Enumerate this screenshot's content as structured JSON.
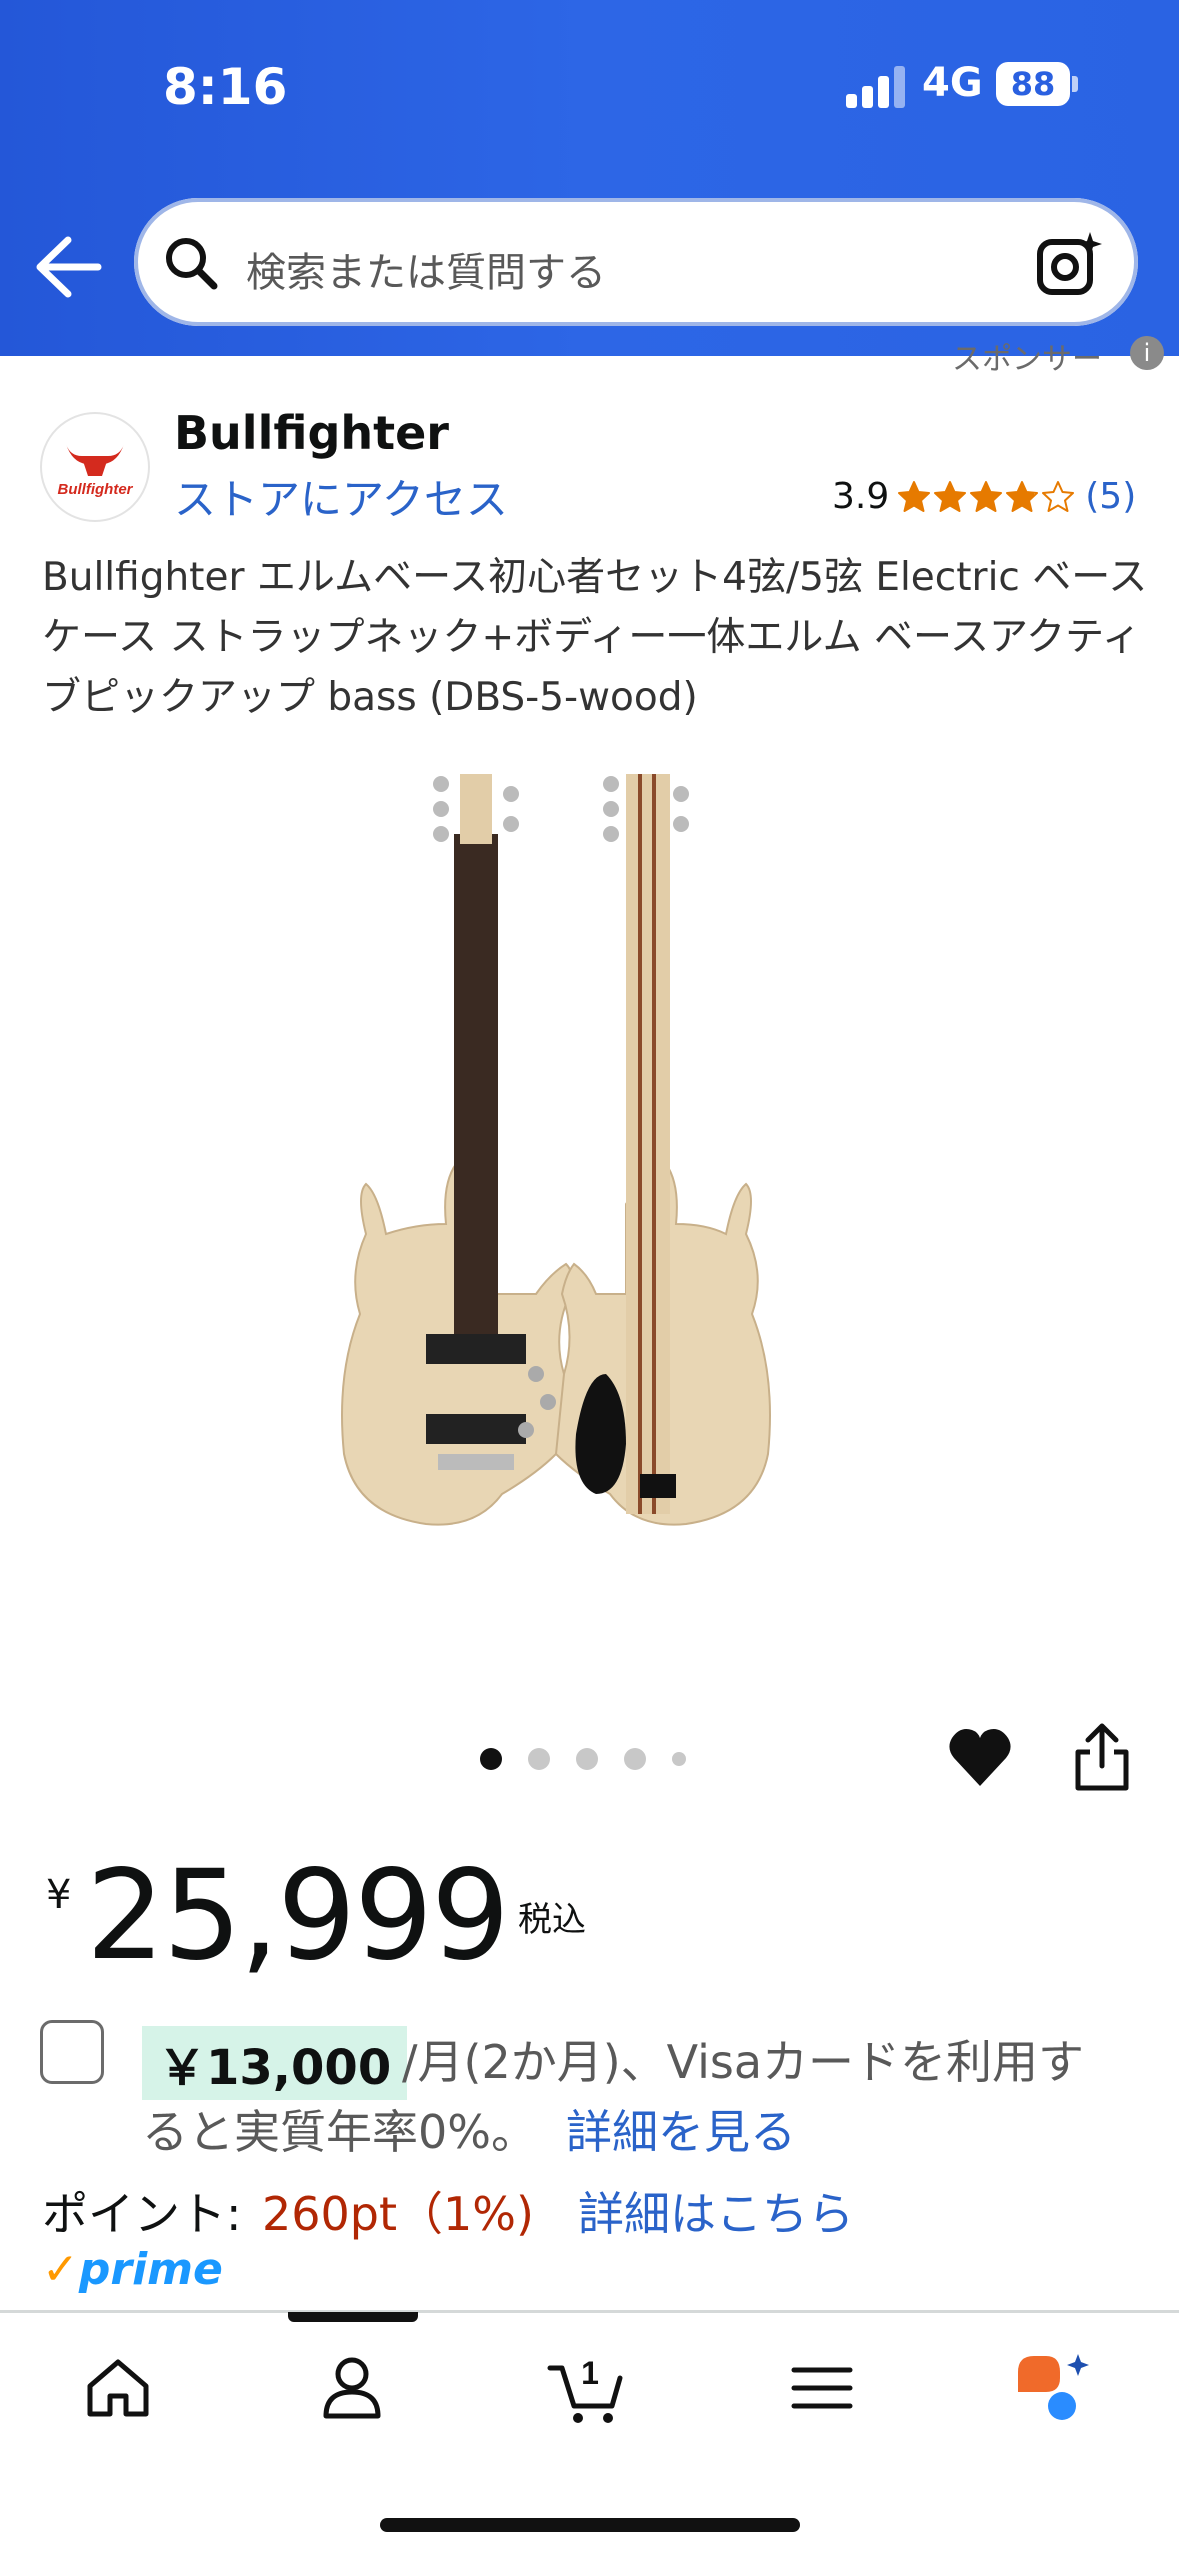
{
  "status": {
    "time": "8:16",
    "network": "4G",
    "battery": "88"
  },
  "search": {
    "placeholder": "検索または質問する"
  },
  "sponsor": {
    "label": "スポンサー",
    "info": "i"
  },
  "seller": {
    "brand": "Bullfighter",
    "logo_text": "Bullfighter",
    "store_link": "ストアにアクセス"
  },
  "rating": {
    "value": "3.9",
    "stars": 3.9,
    "count": "(5)"
  },
  "product": {
    "title": "Bullfighter エルムベース初心者セット4弦/5弦 Electric ベース ケース ストラップネック+ボディー一体エルム ベースアクティブピックアップ bass (DBS-5-wood)"
  },
  "gallery": {
    "dots": 5,
    "active_index": 0
  },
  "price": {
    "symbol": "¥",
    "amount": "25,999",
    "tax_label": "税込"
  },
  "installment": {
    "amount": "￥13,000",
    "text_line1": "/月(2か月)、Visaカードを利用す",
    "text_line2": "ると実質年率0%。",
    "link": "詳細を見る"
  },
  "points": {
    "label": "ポイント:",
    "value": "260pt（1%)",
    "link": "詳細はこちら"
  },
  "prime": {
    "check": "✓",
    "label": "prime"
  },
  "nav": {
    "items": [
      "home-icon",
      "account-icon",
      "cart-icon",
      "menu-icon",
      "rufus-icon"
    ],
    "cart_count": "1"
  },
  "colors": {
    "header": "#2a60e0",
    "link": "#2a63c9",
    "points": "#b12704",
    "promo_bg": "#d6f3e8",
    "star": "#e67a00"
  }
}
